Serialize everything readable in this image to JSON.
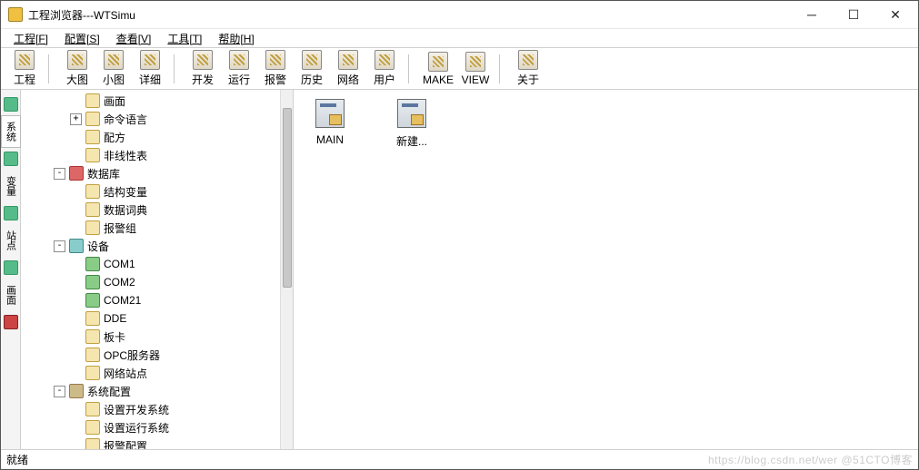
{
  "window": {
    "title": "工程浏览器---WTSimu"
  },
  "menu": [
    "工程[F]",
    "配置[S]",
    "查看[V]",
    "工具[T]",
    "帮助[H]"
  ],
  "toolbar_groups": [
    [
      "工程"
    ],
    [
      "大图",
      "小图",
      "详细"
    ],
    [
      "开发",
      "运行",
      "报警",
      "历史",
      "网络",
      "用户"
    ],
    [
      "MAKE",
      "VIEW"
    ],
    [
      "关于"
    ]
  ],
  "vtabs": [
    "系统",
    "变量",
    "站点",
    "画面"
  ],
  "tree": [
    {
      "d": 3,
      "exp": "",
      "icon": "",
      "label": "画面"
    },
    {
      "d": 3,
      "exp": "+",
      "icon": "",
      "label": "命令语言"
    },
    {
      "d": 3,
      "exp": "",
      "icon": "",
      "label": "配方"
    },
    {
      "d": 3,
      "exp": "",
      "icon": "",
      "label": "非线性表"
    },
    {
      "d": 2,
      "exp": "-",
      "icon": "db",
      "label": "数据库"
    },
    {
      "d": 3,
      "exp": "",
      "icon": "",
      "label": "结构变量"
    },
    {
      "d": 3,
      "exp": "",
      "icon": "",
      "label": "数据词典"
    },
    {
      "d": 3,
      "exp": "",
      "icon": "",
      "label": "报警组"
    },
    {
      "d": 2,
      "exp": "-",
      "icon": "dv",
      "label": "设备"
    },
    {
      "d": 3,
      "exp": "",
      "icon": "com",
      "label": "COM1"
    },
    {
      "d": 3,
      "exp": "",
      "icon": "com",
      "label": "COM2"
    },
    {
      "d": 3,
      "exp": "",
      "icon": "com",
      "label": "COM21"
    },
    {
      "d": 3,
      "exp": "",
      "icon": "",
      "label": "DDE"
    },
    {
      "d": 3,
      "exp": "",
      "icon": "",
      "label": "板卡"
    },
    {
      "d": 3,
      "exp": "",
      "icon": "",
      "label": "OPC服务器"
    },
    {
      "d": 3,
      "exp": "",
      "icon": "",
      "label": "网络站点"
    },
    {
      "d": 2,
      "exp": "-",
      "icon": "sc",
      "label": "系统配置"
    },
    {
      "d": 3,
      "exp": "",
      "icon": "",
      "label": "设置开发系统"
    },
    {
      "d": 3,
      "exp": "",
      "icon": "",
      "label": "设置运行系统"
    },
    {
      "d": 3,
      "exp": "",
      "icon": "",
      "label": "报警配置"
    }
  ],
  "content_items": [
    "MAIN",
    "新建..."
  ],
  "status": "就绪",
  "watermark": "https://blog.csdn.net/wer   @51CTO博客"
}
